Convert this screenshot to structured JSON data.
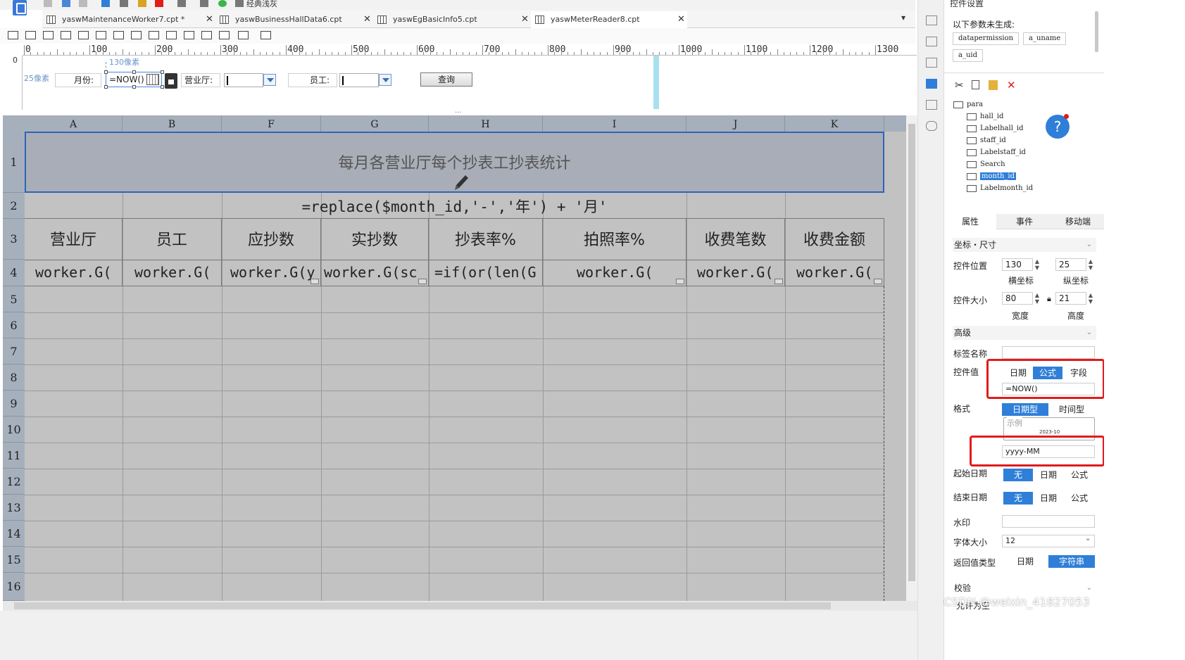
{
  "toolbar": {
    "classic_label": "经典浅灰"
  },
  "tabs": [
    {
      "label": "yaswMaintenanceWorker7.cpt *",
      "close": "✕"
    },
    {
      "label": "yaswBusinessHallData6.cpt",
      "close": "✕"
    },
    {
      "label": "yaswEgBasicInfo5.cpt",
      "close": "✕"
    },
    {
      "label": "yaswMeterReader8.cpt",
      "close": "✕"
    }
  ],
  "ruler": {
    "labels": [
      "0",
      "100",
      "200",
      "300",
      "400",
      "500",
      "600",
      "700",
      "800",
      "900",
      "1000",
      "1100",
      "1200",
      "1300"
    ],
    "vertical_zero": "0"
  },
  "params": {
    "px_25": "25像素",
    "px_130": "130像素",
    "month_label": "月份:",
    "month_value": "=NOW()",
    "hall_label": "营业厅:",
    "staff_label": "员工:",
    "query_label": "查询",
    "divider": "..."
  },
  "grid": {
    "columns": [
      "A",
      "B",
      "F",
      "G",
      "H",
      "I",
      "J",
      "K"
    ],
    "rows": [
      "1",
      "2",
      "3",
      "4",
      "5",
      "6",
      "7",
      "8",
      "9",
      "10",
      "11",
      "12",
      "13",
      "14",
      "15",
      "16"
    ],
    "title": "每月各营业厅每个抄表工抄表统计",
    "formula": "=replace($month_id,'-','年') + '月'",
    "headers": [
      "营业厅",
      "员工",
      "应抄数",
      "实抄数",
      "抄表率%",
      "拍照率%",
      "收费笔数",
      "收费金额"
    ],
    "cells": [
      "worker.G(",
      "worker.G(",
      "worker.G(y",
      "worker.G(sc",
      "=if(or(len(G",
      "worker.G(",
      "worker.G(",
      "worker.G("
    ]
  },
  "panel": {
    "title": "控件设置",
    "unbuilt_label": "以下参数未生成:",
    "unbuilt_params": [
      "datapermission",
      "a_uname",
      "a_uid"
    ],
    "tree": [
      "para",
      "hall_id",
      "Labelhall_id",
      "staff_id",
      "Labelstaff_id",
      "Search",
      "month_id",
      "Labelmonth_id"
    ],
    "help": "?",
    "tabs": [
      "属性",
      "事件",
      "移动端"
    ],
    "section_pos": "坐标・尺寸",
    "pos_label": "控件位置",
    "pos_x": "130",
    "pos_y": "25",
    "x_label": "横坐标",
    "y_label": "纵坐标",
    "size_label": "控件大小",
    "width": "80",
    "height": "21",
    "width_label": "宽度",
    "height_label": "高度",
    "section_adv": "高级",
    "tag_label": "标签名称",
    "value_label": "控件值",
    "value_modes": [
      "日期",
      "公式",
      "字段"
    ],
    "value_active": "公式",
    "value_text": "=NOW()",
    "format_label": "格式",
    "format_modes": [
      "日期型",
      "时间型"
    ],
    "example_label": "示例",
    "example_value": "2023-10",
    "format_text": "yyyy-MM",
    "start_label": "起始日期",
    "end_label": "结束日期",
    "range_modes": [
      "无",
      "日期",
      "公式"
    ],
    "watermark_label": "水印",
    "font_label": "字体大小",
    "font_value": "12",
    "return_label": "返回值类型",
    "return_modes": [
      "日期",
      "字符串"
    ],
    "check_label": "校验",
    "allow_empty": "允许为空",
    "chev": "⌄"
  },
  "footer": {
    "watermark": "CSDN @weixin_41827053"
  },
  "colors": {
    "accent": "#2f7fd8",
    "highlight_red": "#e21b1b",
    "grid_bg": "#c2c2c2",
    "header_bg": "#a6b0bc"
  }
}
